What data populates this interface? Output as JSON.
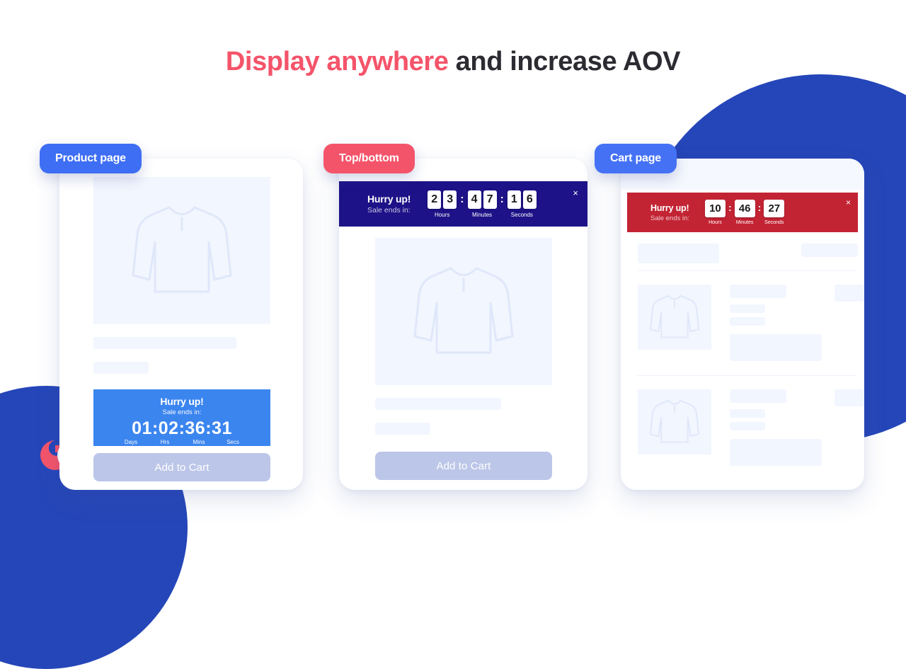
{
  "heading": {
    "highlight": "Display anywhere",
    "rest": " and increase AOV"
  },
  "colors": {
    "accent_red": "#f4546a",
    "accent_blue": "#3e6ef3",
    "deep_blue": "#2546b8",
    "banner_navy": "#1d1287",
    "banner_red": "#c32434",
    "timer_blue": "#3b85ef",
    "button_periwinkle": "#bcc6e8",
    "heading_dark": "#2b2b31"
  },
  "cards": [
    {
      "badge": "Product page",
      "badge_style": "blue",
      "timer": {
        "hurry": "Hurry up!",
        "sub": "Sale ends in:",
        "digits": "01:02:36:31",
        "labels": [
          "Days",
          "Hrs",
          "Mins",
          "Secs"
        ]
      },
      "add_to_cart": "Add to Cart"
    },
    {
      "badge": "Top/bottom",
      "badge_style": "red",
      "banner": {
        "hurry": "Hurry up!",
        "sub": "Sale ends in:",
        "units": [
          {
            "digits": [
              "2",
              "3"
            ],
            "label": "Hours"
          },
          {
            "digits": [
              "4",
              "7"
            ],
            "label": "Minutes"
          },
          {
            "digits": [
              "1",
              "6"
            ],
            "label": "Seconds"
          }
        ],
        "separator": ":",
        "close": "×"
      },
      "add_to_cart": "Add to Cart"
    },
    {
      "badge": "Cart page",
      "badge_style": "blue2",
      "banner": {
        "hurry": "Hurry up!",
        "sub": "Sale ends in:",
        "units": [
          {
            "value": "10",
            "label": "Hours"
          },
          {
            "value": "46",
            "label": "Minutes"
          },
          {
            "value": "27",
            "label": "Seconds"
          }
        ],
        "separator": ":",
        "close": "×"
      }
    }
  ],
  "icons": {
    "shirt": "long-sleeve-shirt-icon",
    "close": "close-icon",
    "logo": "brand-logo"
  }
}
